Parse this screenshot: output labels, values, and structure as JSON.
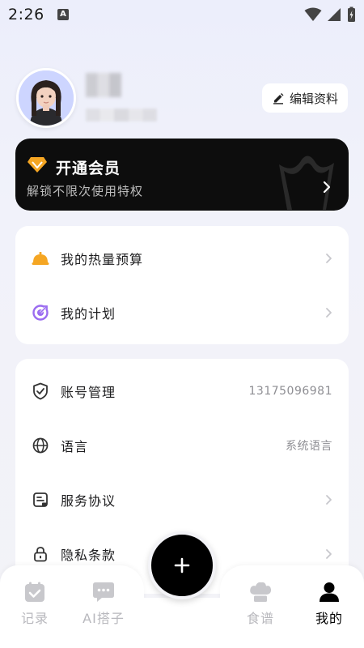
{
  "status_bar": {
    "time": "2:26",
    "notification_letter": "A"
  },
  "profile": {
    "edit_label": "编辑资料"
  },
  "vip": {
    "title": "开通会员",
    "subtitle": "解锁不限次使用特权",
    "accent_color": "#f5a623"
  },
  "menu_primary": [
    {
      "label": "我的热量预算",
      "icon": "food-dome-icon"
    },
    {
      "label": "我的计划",
      "icon": "target-icon"
    }
  ],
  "menu_settings": [
    {
      "label": "账号管理",
      "value": "13175096981",
      "icon": "shield-check-icon"
    },
    {
      "label": "语言",
      "value": "系统语言",
      "icon": "globe-icon"
    },
    {
      "label": "服务协议",
      "value": "",
      "icon": "document-icon"
    },
    {
      "label": "隐私条款",
      "value": "",
      "icon": "lock-icon"
    }
  ],
  "bottom_nav": {
    "items": [
      {
        "label": "记录",
        "icon": "calendar-check-icon",
        "active": false
      },
      {
        "label": "AI搭子",
        "icon": "chat-bubble-icon",
        "active": false
      },
      {
        "label": "食谱",
        "icon": "chef-hat-icon",
        "active": false
      },
      {
        "label": "我的",
        "icon": "person-icon",
        "active": true
      }
    ],
    "fab_icon": "plus-icon"
  }
}
